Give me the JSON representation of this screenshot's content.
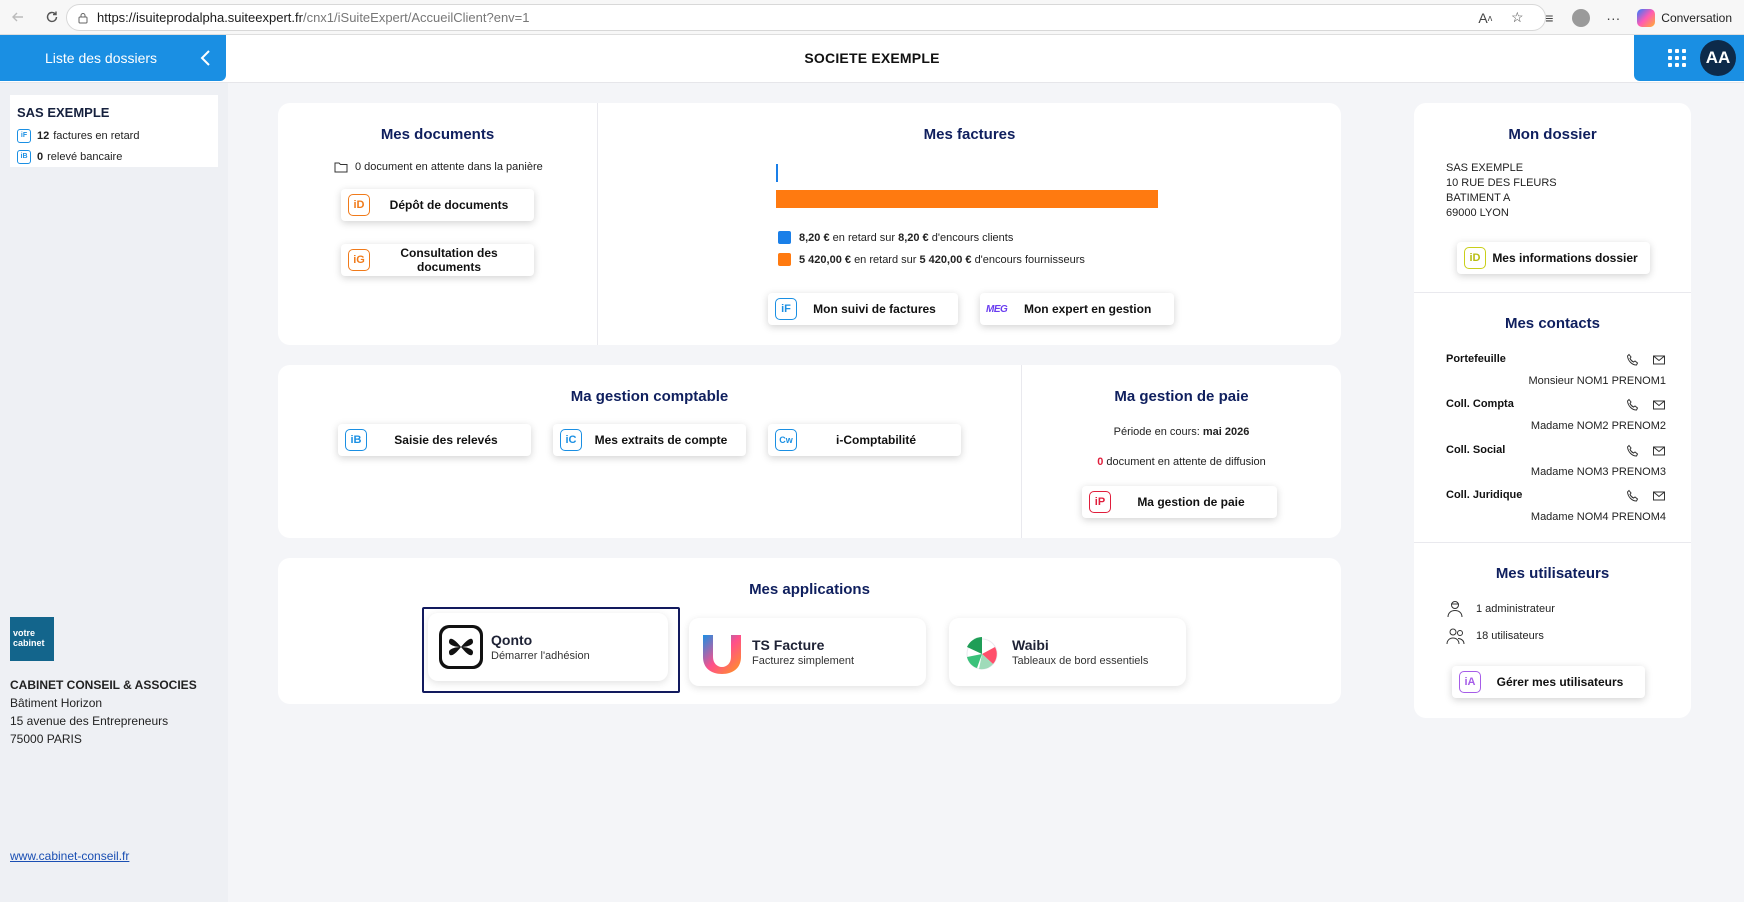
{
  "browser": {
    "url_host": "https://isuiteprodalpha.suiteexpert.fr",
    "url_path": "/cnx1/iSuiteExpert/AccueilClient?env=1",
    "conversation_label": "Conversation"
  },
  "header": {
    "dossiers_tab_label": "Liste des dossiers",
    "company_name": "SOCIETE EXEMPLE",
    "avatar_initials": "AA"
  },
  "sidebar": {
    "summary_title": "SAS EXEMPLE",
    "late_invoices_count": "12",
    "late_invoices_label": "factures en retard",
    "bank_count": "0",
    "bank_label": "relevé bancaire",
    "logo_line1": "votre",
    "logo_line2": "cabinet",
    "cabinet_name": "CABINET CONSEIL & ASSOCIES",
    "cabinet_addr1": "Bâtiment Horizon",
    "cabinet_addr2": "15 avenue des Entrepreneurs",
    "cabinet_addr3": "75000 PARIS",
    "cabinet_url": "www.cabinet-conseil.fr"
  },
  "documents": {
    "title": "Mes documents",
    "pending_text": "0 document en attente dans la panière",
    "depot_icon": "iD",
    "depot_label": "Dépôt de documents",
    "consult_icon": "iG",
    "consult_label": "Consultation des documents"
  },
  "factures": {
    "title": "Mes factures",
    "clients_amount": "8,20 €",
    "clients_mid": "en retard sur",
    "clients_total": "8,20 €",
    "clients_tail": "d'encours clients",
    "suppliers_amount": "5 420,00 €",
    "suppliers_mid": "en retard sur",
    "suppliers_total": "5 420,00 €",
    "suppliers_tail": "d'encours fournisseurs",
    "suivi_icon": "iF",
    "suivi_label": "Mon suivi de factures",
    "expert_icon": "MEG",
    "expert_label": "Mon expert en gestion",
    "bars": {
      "clients_value": 8.2,
      "suppliers_value": 5420.0
    },
    "clients_color": "#1a7fe8",
    "suppliers_color": "#ff7a10"
  },
  "comptable": {
    "title": "Ma gestion comptable",
    "btn1_icon": "iB",
    "btn1_label": "Saisie des relevés",
    "btn2_icon": "iC",
    "btn2_label": "Mes extraits de compte",
    "btn3_icon": "Cw",
    "btn3_label": "i-Comptabilité"
  },
  "paie": {
    "title": "Ma gestion de paie",
    "period_label": "Période en cours:",
    "period_value": "mai 2026",
    "pending_count": "0",
    "pending_text": "document en attente de diffusion",
    "btn_icon": "iP",
    "btn_label": "Ma gestion de paie"
  },
  "applications": {
    "title": "Mes applications",
    "apps": [
      {
        "name": "Qonto",
        "subtitle": "Démarrer l'adhésion"
      },
      {
        "name": "TS Facture",
        "subtitle": "Facturez simplement"
      },
      {
        "name": "Waibi",
        "subtitle": "Tableaux de bord essentiels"
      }
    ]
  },
  "dossier": {
    "title": "Mon dossier",
    "line1": "SAS EXEMPLE",
    "line2": "10 RUE DES FLEURS",
    "line3": "BATIMENT A",
    "line4": "69000 LYON",
    "btn_icon": "iD",
    "btn_label": "Mes informations dossier"
  },
  "contacts": {
    "title": "Mes contacts",
    "items": [
      {
        "role": "Portefeuille",
        "name": "Monsieur NOM1 PRENOM1"
      },
      {
        "role": "Coll. Compta",
        "name": "Madame NOM2 PRENOM2"
      },
      {
        "role": "Coll. Social",
        "name": "Madame NOM3 PRENOM3"
      },
      {
        "role": "Coll. Juridique",
        "name": "Madame NOM4 PRENOM4"
      }
    ]
  },
  "utilisateurs": {
    "title": "Mes utilisateurs",
    "admins": "1 administrateur",
    "users": "18 utilisateurs",
    "btn_icon": "iA",
    "btn_label": "Gérer mes utilisateurs"
  }
}
